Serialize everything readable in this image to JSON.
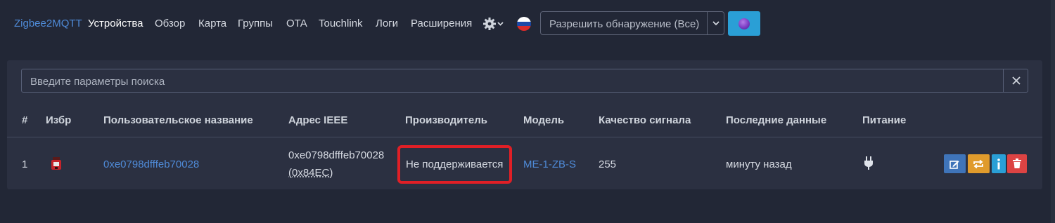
{
  "nav": {
    "brand": "Zigbee2MQTT",
    "items": [
      "Устройства",
      "Обзор",
      "Карта",
      "Группы",
      "OTA",
      "Touchlink",
      "Логи",
      "Расширения"
    ],
    "settings_icon": "gear-icon",
    "language_icon": "russian-flag-icon",
    "permit_join_label": "Разрешить обнаружение (Все)",
    "permit_join_button_icon": "orb-icon"
  },
  "search": {
    "placeholder": "Введите параметры поиска",
    "clear_icon": "close-icon"
  },
  "table": {
    "headers": {
      "index": "#",
      "favorite": "Избр",
      "friendly_name": "Пользовательское название",
      "ieee": "Адрес IEEE",
      "manufacturer": "Производитель",
      "model": "Модель",
      "lqi": "Качество сигнала",
      "last_seen": "Последние данные",
      "power": "Питание"
    },
    "rows": [
      {
        "index": "1",
        "favorite_icon": "device-thumbnail-icon",
        "friendly_name": "0xe0798dfffeb70028",
        "ieee_line1": "0xe0798dfffeb70028",
        "ieee_line2": "(0x84EC)",
        "manufacturer": "Не поддерживается",
        "model": "ME-1-ZB-S",
        "lqi": "255",
        "last_seen": "минуту назад",
        "power_icon": "plug-icon",
        "actions": [
          "edit-icon",
          "rename-icon",
          "info-icon",
          "trash-icon"
        ]
      }
    ]
  },
  "colors": {
    "background": "#222736",
    "card": "#2b3041",
    "link": "#4f8bd8",
    "highlight": "#e01f26",
    "btn_edit": "#3f74b9",
    "btn_rename": "#e09b2c",
    "btn_info": "#2a9fd6",
    "btn_delete": "#dc4343"
  }
}
